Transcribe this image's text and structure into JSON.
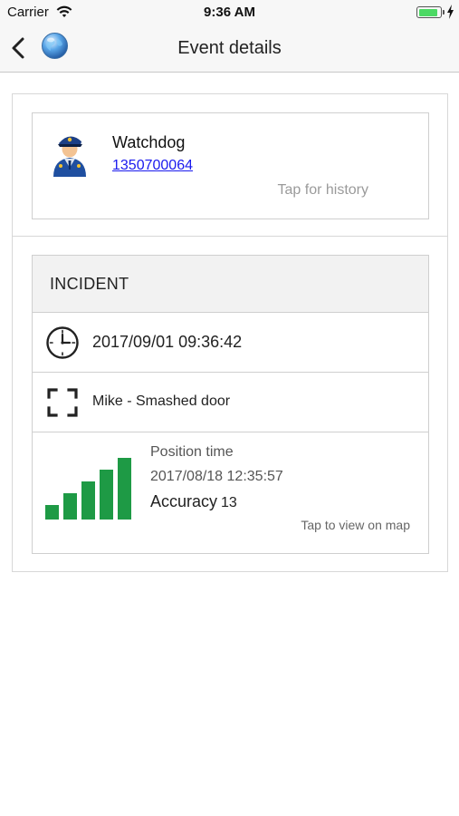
{
  "status_bar": {
    "carrier": "Carrier",
    "time": "9:36 AM",
    "battery_level": 0.92,
    "battery_color": "#4cd964"
  },
  "nav": {
    "title": "Event details",
    "back_icon": "chevron-left-icon",
    "app_icon": "globe-icon"
  },
  "person": {
    "name": "Watchdog",
    "phone": "1350700064",
    "history_link": "Tap for history",
    "avatar_icon": "police-officer-icon",
    "link_color": "#1a1aee"
  },
  "incident": {
    "header": "INCIDENT",
    "timestamp": "2017/09/01 09:36:42",
    "description": "Mike - Smashed door",
    "position_label": "Position time",
    "position_time": "2017/08/18 12:35:57",
    "accuracy_label": "Accuracy",
    "accuracy_value": "13",
    "map_link": "Tap to view on map",
    "signal_bars": 5,
    "signal_color": "#1e9a45"
  }
}
